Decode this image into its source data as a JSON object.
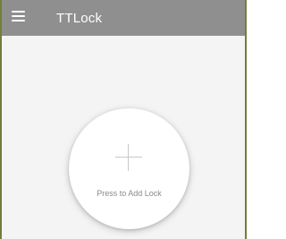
{
  "app_bar": {
    "title": "TTLock",
    "menu_icon": "hamburger-menu-icon",
    "background_color": "#8f8f8f"
  },
  "main": {
    "add_lock_label": "Press to Add Lock",
    "add_icon": "plus-icon"
  }
}
